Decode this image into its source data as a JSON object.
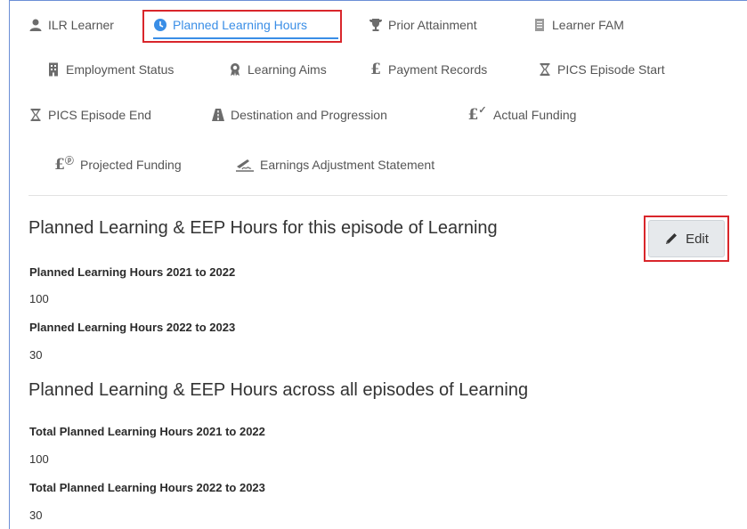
{
  "tabs": {
    "ilr_learner": "ILR Learner",
    "planned_learning_hours": "Planned Learning Hours",
    "prior_attainment": "Prior Attainment",
    "learner_fam": "Learner FAM",
    "employment_status": "Employment Status",
    "learning_aims": "Learning Aims",
    "payment_records": "Payment Records",
    "pics_episode_start": "PICS Episode Start",
    "pics_episode_end": "PICS Episode End",
    "destination_progression": "Destination and Progression",
    "actual_funding": "Actual Funding",
    "projected_funding": "Projected Funding",
    "earnings_adjustment": "Earnings Adjustment Statement"
  },
  "active_tab": "Planned Learning Hours",
  "icons": {
    "ilr_learner": "user-icon",
    "planned_learning_hours": "clock-icon",
    "prior_attainment": "trophy-icon",
    "learner_fam": "document-icon",
    "employment_status": "building-icon",
    "learning_aims": "award-icon",
    "payment_records": "pound-icon",
    "pics_episode_start": "hourglass-icon",
    "pics_episode_end": "hourglass-icon",
    "destination_progression": "road-icon",
    "actual_funding": "pound-check-icon",
    "projected_funding": "pound-projected-icon",
    "earnings_adjustment": "signature-icon"
  },
  "colors": {
    "accent": "#3a8ee6",
    "highlight": "#d9262b"
  },
  "episode_section": {
    "title": "Planned Learning & EEP Hours for this episode of Learning",
    "fields": [
      {
        "label": "Planned Learning Hours 2021 to 2022",
        "value": "100"
      },
      {
        "label": "Planned Learning Hours 2022 to 2023",
        "value": "30"
      }
    ]
  },
  "all_section": {
    "title": "Planned Learning & EEP Hours across all episodes of Learning",
    "fields": [
      {
        "label": "Total Planned Learning Hours 2021 to 2022",
        "value": "100"
      },
      {
        "label": "Total Planned Learning Hours 2022 to 2023",
        "value": "30"
      }
    ]
  },
  "edit_button": {
    "label": "Edit",
    "icon": "pencil-icon"
  }
}
